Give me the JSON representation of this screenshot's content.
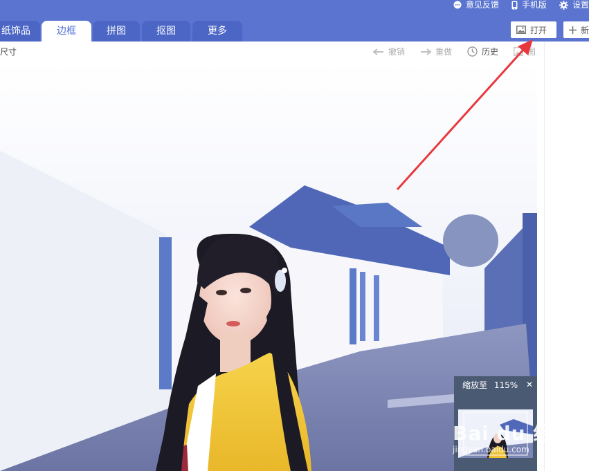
{
  "header": {
    "links": [
      {
        "label": "意见反馈",
        "icon": "chat-bubble-icon"
      },
      {
        "label": "手机版",
        "icon": "phone-icon"
      },
      {
        "label": "设置",
        "icon": "gear-icon"
      }
    ],
    "tabs": [
      {
        "label": "纸饰品"
      },
      {
        "label": "边框"
      },
      {
        "label": "拼图"
      },
      {
        "label": "抠图"
      },
      {
        "label": "更多"
      }
    ],
    "active_tab": "边框",
    "open_button": "打开",
    "new_button": "新"
  },
  "toolbar": {
    "left_label": "尺寸",
    "undo": "撤销",
    "redo": "重做",
    "history": "历史",
    "fourth": "图"
  },
  "zoom": {
    "label": "缩放至",
    "value": "115%",
    "close": "✕"
  },
  "watermark": {
    "brand": "Bai du 经验",
    "url": "jingyan.baidu.com"
  },
  "colors": {
    "header_bg": "#5a74d0",
    "active_tab_text": "#4a68d4",
    "arrow": "#e8383d"
  }
}
